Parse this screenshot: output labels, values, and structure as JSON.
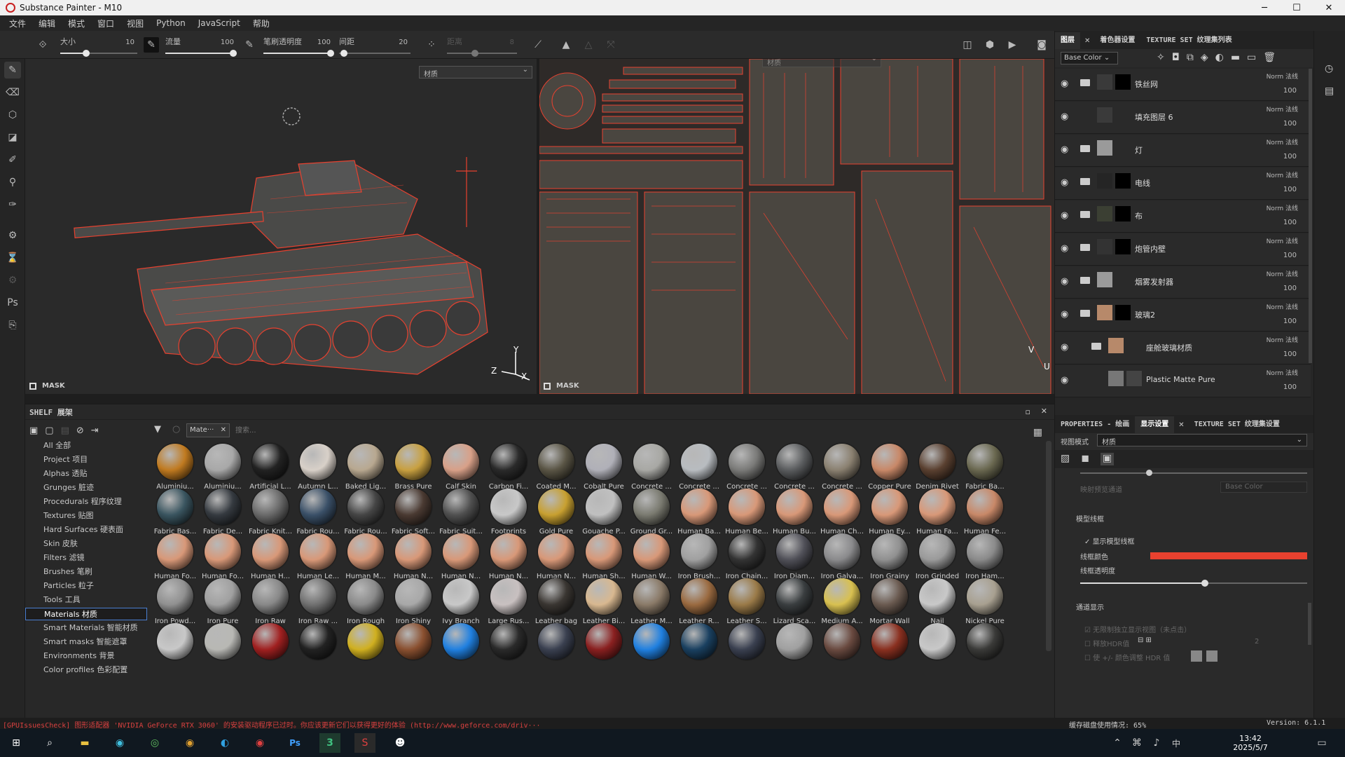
{
  "window": {
    "title": "Substance Painter - M10",
    "minimize": "─",
    "maximize": "☐",
    "close": "✕"
  },
  "menu": [
    "文件",
    "编辑",
    "模式",
    "窗口",
    "视图",
    "Python",
    "JavaScript",
    "帮助"
  ],
  "toolbar": {
    "size": {
      "label": "大小",
      "value": "10"
    },
    "flow": {
      "label": "流量",
      "value": "100"
    },
    "stroke_opacity": {
      "label": "笔刷透明度",
      "value": "100"
    },
    "spacing": {
      "label": "间距",
      "value": "20"
    },
    "distance": {
      "label": "距离",
      "value": "8"
    }
  },
  "viewport3d": {
    "mode_select": "材质",
    "mask_label": "MASK",
    "axis_y": "Y",
    "axis_z": "Z",
    "axis_x": "X"
  },
  "viewport2d": {
    "mode_select": "材质",
    "mask_label": "MASK",
    "axis_v": "V",
    "axis_u": "U"
  },
  "layers_panel": {
    "tabs": [
      "图层",
      "着色器设置",
      "TEXTURE SET 纹理集列表"
    ],
    "channel_select": "Base Color",
    "layers": [
      {
        "name": "铁丝网",
        "blend": "Norm 法线",
        "opacity": "100",
        "folder": true,
        "thumb1": "#3a3a3a",
        "thumb2": "#000000"
      },
      {
        "name": "填充图层 6",
        "blend": "Norm 法线",
        "opacity": "100",
        "folder": false,
        "thumb1": "#3a3a3a",
        "thumb2": ""
      },
      {
        "name": "灯",
        "blend": "Norm 法线",
        "opacity": "100",
        "folder": true,
        "thumb1": "#9a9a9a",
        "thumb2": ""
      },
      {
        "name": "电线",
        "blend": "Norm 法线",
        "opacity": "100",
        "folder": true,
        "thumb1": "#252525",
        "thumb2": "#000000"
      },
      {
        "name": "布",
        "blend": "Norm 法线",
        "opacity": "100",
        "folder": true,
        "thumb1": "#3b3f33",
        "thumb2": "#000000"
      },
      {
        "name": "炮管内壁",
        "blend": "Norm 法线",
        "opacity": "100",
        "folder": true,
        "thumb1": "#333333",
        "thumb2": "#000000"
      },
      {
        "name": "烟雾发射器",
        "blend": "Norm 法线",
        "opacity": "100",
        "folder": true,
        "thumb1": "#9a9a9a",
        "thumb2": ""
      },
      {
        "name": "玻璃2",
        "blend": "Norm 法线",
        "opacity": "100",
        "folder": true,
        "thumb1": "#b7896a",
        "thumb2": "#000000"
      },
      {
        "name": "座舱玻璃材质",
        "blend": "Norm 法线",
        "opacity": "100",
        "folder": true,
        "thumb1": "#b7896a",
        "thumb2": ""
      },
      {
        "name": "Plastic Matte Pure",
        "blend": "Norm 法线",
        "opacity": "100",
        "folder": false,
        "thumb1": "#777777",
        "thumb2": "#444444"
      }
    ]
  },
  "properties_panel": {
    "tabs": [
      "PROPERTIES - 绘画",
      "显示设置",
      "TEXTURE SET 纹理集设置"
    ],
    "view_mode_label": "视图模式",
    "view_mode_value": "材质",
    "channel_label": "映射预览通道",
    "channel_value": "Base Color",
    "wireframe_section": "模型线框",
    "show_wireframe": "显示模型线框",
    "wire_color_label": "线框颜色",
    "wire_color": "#e8412f",
    "wire_opacity_label": "线框透明度",
    "wire_opacity": 0.55,
    "channel_section": "通道显示",
    "channel_opt1": "无限制独立显示视图（未点击）",
    "channel_opt2": "释放HDR值",
    "channel_opt2_val": "2",
    "channel_opt3": "使 +/- 颜色调整 HDR 值"
  },
  "shelf": {
    "title": "SHELF 展架",
    "filter_tag": "Mate···",
    "search_placeholder": "搜索...",
    "categories": [
      "All 全部",
      "Project 项目",
      "Alphas 透贴",
      "Grunges 脏迹",
      "Procedurals 程序纹理",
      "Textures 贴图",
      "Hard Surfaces 硬表面",
      "Skin 皮肤",
      "Filters 滤镜",
      "Brushes 笔刷",
      "Particles 粒子",
      "Tools 工具",
      "Materials 材质",
      "Smart Materials 智能材质",
      "Smart masks 智能遮罩",
      "Environments 背景",
      "Color profiles 色彩配置"
    ],
    "selected_category": 12,
    "items": [
      {
        "name": "Aluminiu...",
        "c": "#c07a20"
      },
      {
        "name": "Aluminiu...",
        "c": "#a8a8a8"
      },
      {
        "name": "Artificial L...",
        "c": "#222222"
      },
      {
        "name": "Autumn L...",
        "c": "#d8d0c8"
      },
      {
        "name": "Baked Lig...",
        "c": "#b8a890"
      },
      {
        "name": "Brass Pure",
        "c": "#c8a040"
      },
      {
        "name": "Calf Skin",
        "c": "#d8a088"
      },
      {
        "name": "Carbon Fi...",
        "c": "#2a2a2a"
      },
      {
        "name": "Coated M...",
        "c": "#5a5545"
      },
      {
        "name": "Cobalt Pure",
        "c": "#b0b0b8"
      },
      {
        "name": "Concrete ...",
        "c": "#a8a8a4"
      },
      {
        "name": "Concrete ...",
        "c": "#b8bcc0"
      },
      {
        "name": "Concrete ...",
        "c": "#7a7a78"
      },
      {
        "name": "Concrete ...",
        "c": "#5a5c5e"
      },
      {
        "name": "Concrete ...",
        "c": "#8a8070"
      },
      {
        "name": "Copper Pure",
        "c": "#c88868"
      },
      {
        "name": "Denim Rivet",
        "c": "#5a4030"
      },
      {
        "name": "Fabric Ba...",
        "c": "#6a6850"
      },
      {
        "name": "Fabric Bas...",
        "c": "#3a5560"
      },
      {
        "name": "Fabric De...",
        "c": "#353a40"
      },
      {
        "name": "Fabric Knit...",
        "c": "#6a6a6a"
      },
      {
        "name": "Fabric Rou...",
        "c": "#3a5068"
      },
      {
        "name": "Fabric Rou...",
        "c": "#454545"
      },
      {
        "name": "Fabric Soft...",
        "c": "#4a3a32"
      },
      {
        "name": "Fabric Suit...",
        "c": "#505050"
      },
      {
        "name": "Footprints",
        "c": "#c8c8c8"
      },
      {
        "name": "Gold Pure",
        "c": "#c8a030"
      },
      {
        "name": "Gouache P...",
        "c": "#c0c0c0"
      },
      {
        "name": "Ground Gr...",
        "c": "#7a7a70"
      },
      {
        "name": "Human Ba...",
        "c": "#d89878"
      },
      {
        "name": "Human Be...",
        "c": "#d89878"
      },
      {
        "name": "Human Bu...",
        "c": "#d89878"
      },
      {
        "name": "Human Ch...",
        "c": "#d89878"
      },
      {
        "name": "Human Ey...",
        "c": "#d89878"
      },
      {
        "name": "Human Fa...",
        "c": "#d89878"
      },
      {
        "name": "Human Fe...",
        "c": "#c88868"
      },
      {
        "name": "Human Fo...",
        "c": "#d89878"
      },
      {
        "name": "Human Fo...",
        "c": "#d89878"
      },
      {
        "name": "Human H...",
        "c": "#d89878"
      },
      {
        "name": "Human Le...",
        "c": "#d89878"
      },
      {
        "name": "Human M...",
        "c": "#d89878"
      },
      {
        "name": "Human N...",
        "c": "#d89878"
      },
      {
        "name": "Human N...",
        "c": "#d89878"
      },
      {
        "name": "Human N...",
        "c": "#d89878"
      },
      {
        "name": "Human N...",
        "c": "#d89878"
      },
      {
        "name": "Human Sh...",
        "c": "#d89878"
      },
      {
        "name": "Human W...",
        "c": "#d89878"
      },
      {
        "name": "Iron Brush...",
        "c": "#a0a0a0"
      },
      {
        "name": "Iron Chain...",
        "c": "#333333"
      },
      {
        "name": "Iron Diam...",
        "c": "#505058"
      },
      {
        "name": "Iron Galva...",
        "c": "#8a8a8c"
      },
      {
        "name": "Iron Grainy",
        "c": "#909090"
      },
      {
        "name": "Iron Grinded",
        "c": "#9a9a9a"
      },
      {
        "name": "Iron Ham...",
        "c": "#8a8a8a"
      },
      {
        "name": "Iron Powd...",
        "c": "#909090"
      },
      {
        "name": "Iron Pure",
        "c": "#a0a0a0"
      },
      {
        "name": "Iron Raw",
        "c": "#888888"
      },
      {
        "name": "Iron Raw ...",
        "c": "#707070"
      },
      {
        "name": "Iron Rough",
        "c": "#8a8a8a"
      },
      {
        "name": "Iron Shiny",
        "c": "#a8a8a8"
      },
      {
        "name": "Ivy Branch",
        "c": "#c8c8c8"
      },
      {
        "name": "Large Rus...",
        "c": "#c8c0c0"
      },
      {
        "name": "Leather bag",
        "c": "#3a3632"
      },
      {
        "name": "Leather Bi...",
        "c": "#d8b890"
      },
      {
        "name": "Leather M...",
        "c": "#8a7a68"
      },
      {
        "name": "Leather R...",
        "c": "#9a6a40"
      },
      {
        "name": "Leather S...",
        "c": "#9a7a48"
      },
      {
        "name": "Lizard Sca...",
        "c": "#3a3e40"
      },
      {
        "name": "Medium A...",
        "c": "#d8c050"
      },
      {
        "name": "Mortar Wall",
        "c": "#6a5a50"
      },
      {
        "name": "Nail",
        "c": "#c8c8c8"
      },
      {
        "name": "Nickel Pure",
        "c": "#a8a090"
      },
      {
        "name": "",
        "c": "#c8c8c8"
      },
      {
        "name": "",
        "c": "#b8b8b4"
      },
      {
        "name": "",
        "c": "#a02020"
      },
      {
        "name": "",
        "c": "#222222"
      },
      {
        "name": "",
        "c": "#d0b020"
      },
      {
        "name": "",
        "c": "#8a5030"
      },
      {
        "name": "",
        "c": "#2080e0"
      },
      {
        "name": "",
        "c": "#2a2a2a"
      },
      {
        "name": "",
        "c": "#3a4050"
      },
      {
        "name": "",
        "c": "#8a2020"
      },
      {
        "name": "",
        "c": "#2080e0"
      },
      {
        "name": "",
        "c": "#1a4060"
      },
      {
        "name": "",
        "c": "#3a4050"
      },
      {
        "name": "",
        "c": "#a0a0a0"
      },
      {
        "name": "",
        "c": "#6a4a40"
      },
      {
        "name": "",
        "c": "#8a3020"
      },
      {
        "name": "",
        "c": "#c8c8c8"
      },
      {
        "name": "",
        "c": "#3a3a38"
      }
    ]
  },
  "status": {
    "message": "[GPUIssuesCheck] 图形适配器 'NVIDIA GeForce RTX 3060' 的安装驱动程序已过时。你应该更新它们以获得更好的体验 (http://www.geforce.com/driv···",
    "disk": "缓存磁盘使用情况:  65%",
    "version": "Version: 6.1.1"
  },
  "taskbar": {
    "time": "13:42",
    "date": "2025/5/7",
    "ime": "中"
  },
  "colors": {
    "wire": "#e8412f",
    "accent": "#4a7fd1"
  }
}
